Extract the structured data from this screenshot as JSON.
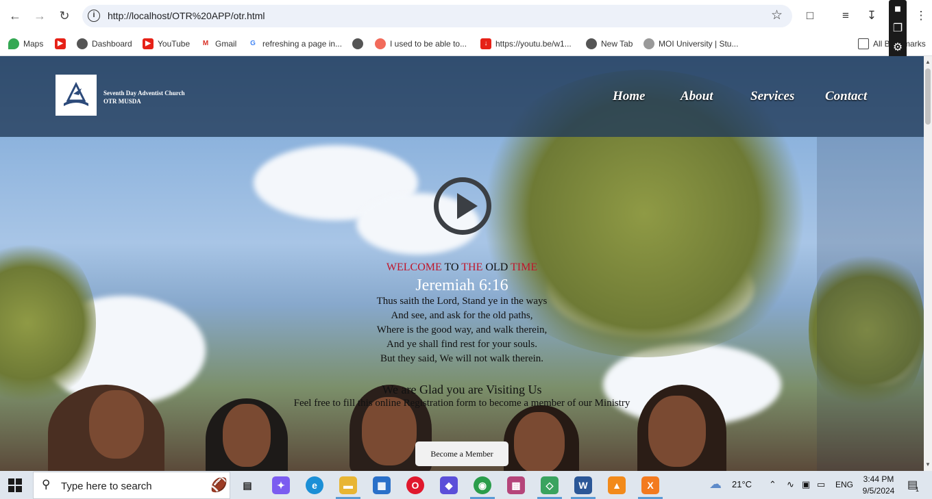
{
  "browser": {
    "url": "http://localhost/OTR%20APP/otr.html",
    "bookmarks": [
      {
        "label": "Maps"
      },
      {
        "label": ""
      },
      {
        "label": "Dashboard"
      },
      {
        "label": "YouTube"
      },
      {
        "label": "Gmail"
      },
      {
        "label": "refreshing a page in..."
      },
      {
        "label": ""
      },
      {
        "label": "I used to be able to..."
      },
      {
        "label": "https://youtu.be/w1..."
      },
      {
        "label": "New Tab"
      },
      {
        "label": "MOI University | Stu..."
      },
      {
        "label": "All Bookmarks"
      }
    ]
  },
  "site": {
    "logo_line1": "Seventh Day Adventist Church",
    "logo_line2": "OTR MUSDA",
    "menu": [
      "Home",
      "About",
      "Services",
      "Contact"
    ],
    "welcome": {
      "w1": "WELCOME",
      "w2": "TO",
      "w3": "THE",
      "w4": "OLD",
      "w5": "TIME"
    },
    "verse_ref": "Jeremiah 6:16",
    "verse_lines": [
      "Thus saith the Lord, Stand ye in the ways",
      "And see, and ask for the old paths,",
      "Where is the good way, and walk therein,",
      "And ye shall find rest for your souls.",
      "But they said, We will not walk therein."
    ],
    "glad": "We are Glad you are Visiting Us",
    "feel_free": "Feel free to fill this online Registration form to become a member of our Ministry",
    "member_button": "Become a Member"
  },
  "taskbar": {
    "search_placeholder": "Type here to search",
    "weather": "21°C",
    "language": "ENG",
    "time": "3:44 PM",
    "date": "9/5/2024",
    "notification_count": "1"
  }
}
